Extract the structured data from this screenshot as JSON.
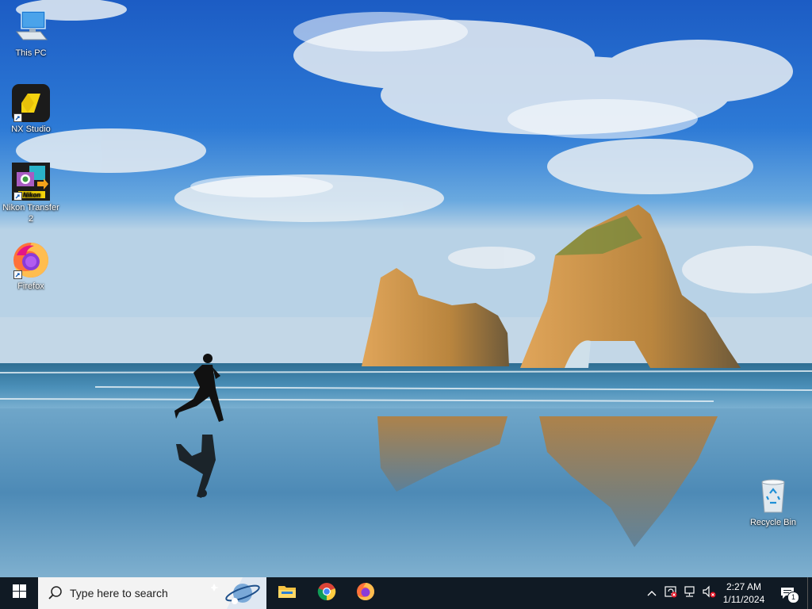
{
  "desktop": {
    "icons": [
      {
        "label": "This PC",
        "icon": "computer-icon"
      },
      {
        "label": "NX Studio",
        "icon": "nx-studio-icon"
      },
      {
        "label": "Nikon Transfer 2",
        "icon": "nikon-transfer-icon"
      },
      {
        "label": "Firefox",
        "icon": "firefox-icon"
      },
      {
        "label": "Recycle Bin",
        "icon": "recycle-bin-icon"
      }
    ]
  },
  "taskbar": {
    "search_placeholder": "Type here to search",
    "pinned": [
      {
        "name": "File Explorer",
        "icon": "folder-icon"
      },
      {
        "name": "Google Chrome",
        "icon": "chrome-icon"
      },
      {
        "name": "Firefox",
        "icon": "firefox-icon"
      }
    ],
    "tray": {
      "time": "2:27 AM",
      "date": "1/11/2024",
      "notification_count": "1"
    }
  },
  "colors": {
    "taskbar_bg": "#101a24",
    "sky_top": "#1f63c8",
    "sea": "#3a7fae"
  }
}
